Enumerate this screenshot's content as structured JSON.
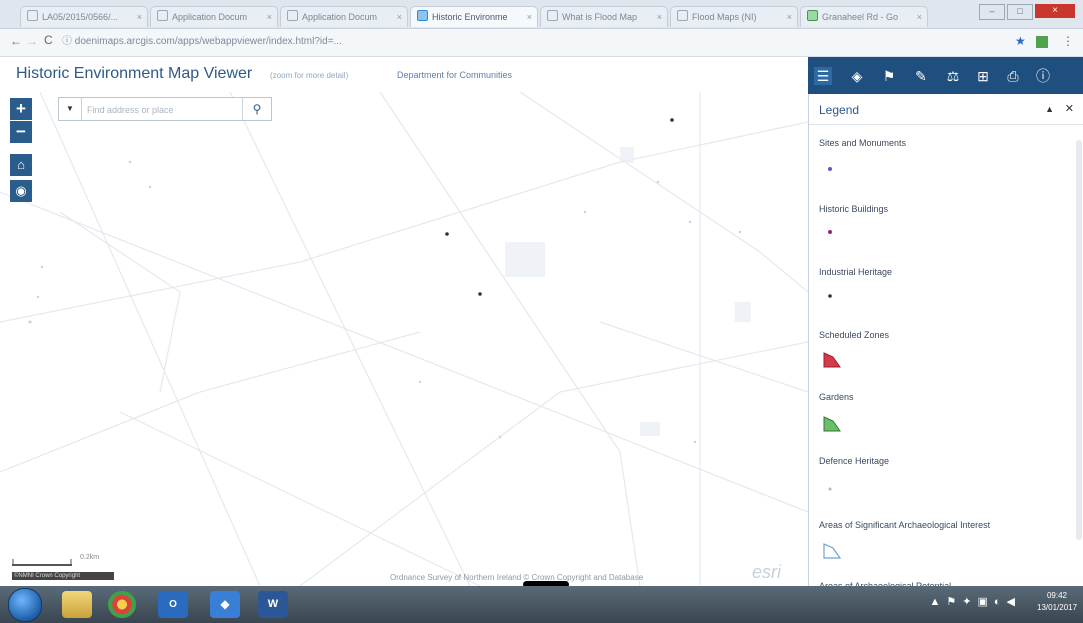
{
  "browser": {
    "tabs": [
      {
        "label": "LA05/2015/0566/..."
      },
      {
        "label": "Application Docum"
      },
      {
        "label": "Application Docum"
      },
      {
        "label": "Historic Environme",
        "active": true
      },
      {
        "label": "What is Flood Map"
      },
      {
        "label": "Flood Maps (NI)"
      },
      {
        "label": "Granaheel Rd - Go"
      }
    ],
    "url": "doenimaps.arcgis.com/apps/webappviewer/index.html?id=..."
  },
  "app": {
    "title": "Historic Environment Map Viewer",
    "zoom_hint": "(zoom for more detail)",
    "department": "Department for Communities"
  },
  "map": {
    "zoom_in": "+",
    "zoom_out": "−",
    "search_placeholder": "Find address or place",
    "scale_text": "0.2km",
    "attribution": "©NMNI Crown Copyright",
    "copyright": "Ordnance Survey of Northern Ireland © Crown Copyright and Database",
    "esri": "esri"
  },
  "legend": {
    "title": "Legend",
    "items": [
      {
        "label": "Sites and Monuments",
        "color": "#5a5fbf"
      },
      {
        "label": "Historic Buildings",
        "color": "#8c2a6b"
      },
      {
        "label": "Industrial Heritage",
        "color": "#333333"
      },
      {
        "label": "Scheduled Zones",
        "color": "#d4394d"
      },
      {
        "label": "Gardens",
        "color": "#4caf50"
      },
      {
        "label": "Defence Heritage",
        "color": "#b0b8c0"
      },
      {
        "label": "Areas of Significant Archaeological Interest",
        "color": "#9fc8e8"
      },
      {
        "label": "Areas of Archaeological Potential",
        "color": "#9fc8e8"
      }
    ]
  },
  "taskbar": {
    "time": "09:42",
    "date": "13/01/2017"
  },
  "colors": {
    "header_blue": "#1f4f7f",
    "title_blue": "#2e5a88"
  }
}
